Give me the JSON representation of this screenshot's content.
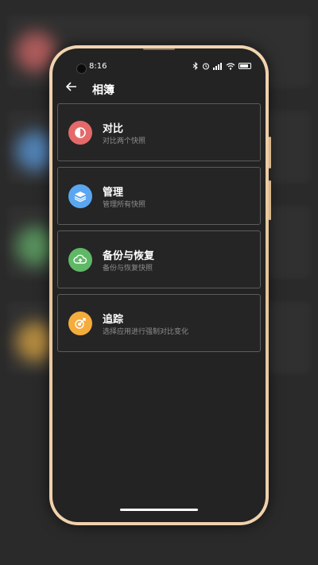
{
  "status_bar": {
    "time": "8:16",
    "icons": [
      "bluetooth-icon",
      "alarm-icon",
      "signal-icon",
      "wifi-icon",
      "battery-icon"
    ]
  },
  "app_bar": {
    "back_icon": "arrow-left-icon",
    "title": "相簿"
  },
  "menu": {
    "items": [
      {
        "title": "对比",
        "subtitle": "对比两个快照",
        "icon": "compare-icon",
        "color": "#e46a6a"
      },
      {
        "title": "管理",
        "subtitle": "管理所有快照",
        "icon": "layers-icon",
        "color": "#5aa6f0"
      },
      {
        "title": "备份与恢复",
        "subtitle": "备份与恢复快照",
        "icon": "cloud-upload-icon",
        "color": "#5fb866"
      },
      {
        "title": "追踪",
        "subtitle": "选择应用进行强制对比变化",
        "icon": "target-icon",
        "color": "#f4ac3c"
      }
    ]
  }
}
